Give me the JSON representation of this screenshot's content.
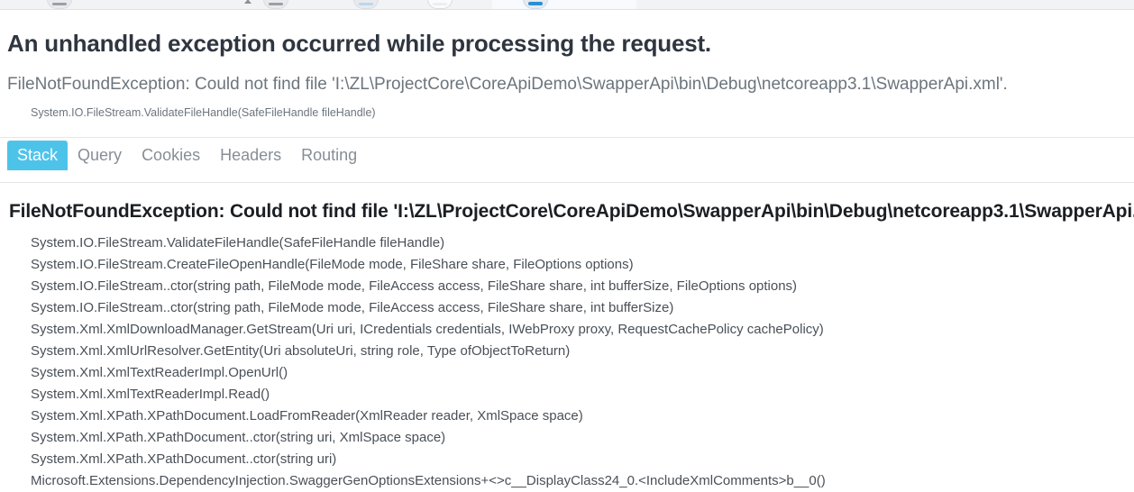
{
  "browser_chrome": {
    "visible_fragment": true,
    "icons": [
      "toolbar-chip-icon",
      "caret-icon",
      "toolbar-chip-icon",
      "toolbar-chip-icon",
      "toolbar-chip-icon",
      "toolbar-chip-icon"
    ]
  },
  "page": {
    "title": "An unhandled exception occurred while processing the request.",
    "subtitle": "FileNotFoundException: Could not find file 'I:\\ZL\\ProjectCore\\CoreApiDemo\\SwapperApi\\bin\\Debug\\netcoreapp3.1\\SwapperApi.xml'.",
    "top_frame": "System.IO.FileStream.ValidateFileHandle(SafeFileHandle fileHandle)"
  },
  "tabs": {
    "active": "Stack",
    "items": [
      {
        "label": "Stack",
        "active": true
      },
      {
        "label": "Query",
        "active": false
      },
      {
        "label": "Cookies",
        "active": false
      },
      {
        "label": "Headers",
        "active": false
      },
      {
        "label": "Routing",
        "active": false
      }
    ]
  },
  "stack": {
    "exception_title": "FileNotFoundException: Could not find file 'I:\\ZL\\ProjectCore\\CoreApiDemo\\SwapperApi\\bin\\Debug\\netcoreapp3.1\\SwapperApi.xml'.",
    "frames": [
      "System.IO.FileStream.ValidateFileHandle(SafeFileHandle fileHandle)",
      "System.IO.FileStream.CreateFileOpenHandle(FileMode mode, FileShare share, FileOptions options)",
      "System.IO.FileStream..ctor(string path, FileMode mode, FileAccess access, FileShare share, int bufferSize, FileOptions options)",
      "System.IO.FileStream..ctor(string path, FileMode mode, FileAccess access, FileShare share, int bufferSize)",
      "System.Xml.XmlDownloadManager.GetStream(Uri uri, ICredentials credentials, IWebProxy proxy, RequestCachePolicy cachePolicy)",
      "System.Xml.XmlUrlResolver.GetEntity(Uri absoluteUri, string role, Type ofObjectToReturn)",
      "System.Xml.XmlTextReaderImpl.OpenUrl()",
      "System.Xml.XmlTextReaderImpl.Read()",
      "System.Xml.XPath.XPathDocument.LoadFromReader(XmlReader reader, XmlSpace space)",
      "System.Xml.XPath.XPathDocument..ctor(string uri, XmlSpace space)",
      "System.Xml.XPath.XPathDocument..ctor(string uri)",
      "Microsoft.Extensions.DependencyInjection.SwaggerGenOptionsExtensions+<>c__DisplayClass24_0.<IncludeXmlComments>b__0()"
    ]
  },
  "colors": {
    "active_tab_bg": "#4ec3ea",
    "active_tab_text": "#ffffff",
    "tab_text": "#868e96",
    "title_text": "#2f3640",
    "subtitle_text": "#6c757d",
    "frame_text": "#495057",
    "rule": "#e6e6e6",
    "page_bg": "#ffffff"
  }
}
